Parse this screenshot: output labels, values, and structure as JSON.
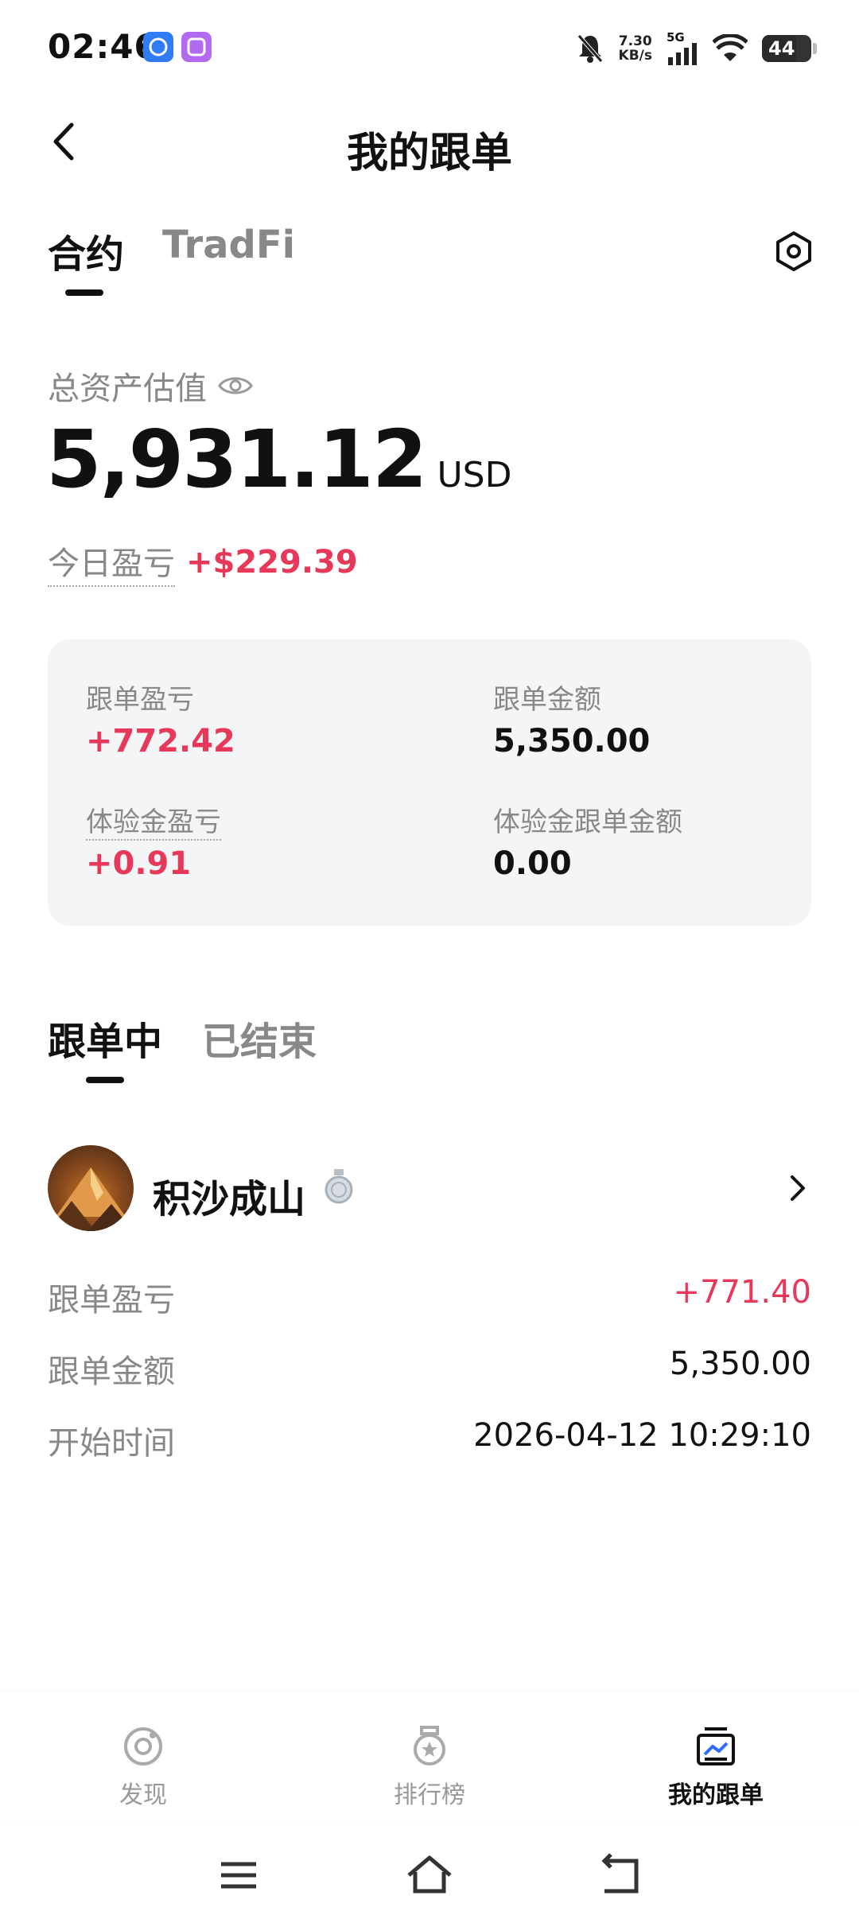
{
  "status_bar": {
    "time": "02:46",
    "net_speed_value": "7.30",
    "net_speed_unit": "KB/s",
    "network": "5G",
    "battery": "44"
  },
  "header": {
    "title": "我的跟单"
  },
  "top_tabs": [
    {
      "label": "合约",
      "active": true
    },
    {
      "label": "TradFi",
      "active": false
    }
  ],
  "assets": {
    "label": "总资产估值",
    "amount": "5,931.12",
    "unit": "USD",
    "today_pnl_label": "今日盈亏",
    "today_pnl_value": "+$229.39"
  },
  "summary_card": {
    "copy_pnl_label": "跟单盈亏",
    "copy_pnl_value": "+772.42",
    "copy_amount_label": "跟单金额",
    "copy_amount_value": "5,350.00",
    "trial_pnl_label": "体验金盈亏",
    "trial_pnl_value": "+0.91",
    "trial_amount_label": "体验金跟单金额",
    "trial_amount_value": "0.00"
  },
  "sub_tabs": [
    {
      "label": "跟单中",
      "active": true
    },
    {
      "label": "已结束",
      "active": false
    }
  ],
  "trader": {
    "name": "积沙成山",
    "details": [
      {
        "label": "跟单盈亏",
        "value": "+771.40"
      },
      {
        "label": "跟单金额",
        "value": "5,350.00"
      },
      {
        "label": "开始时间",
        "value": "2026-04-12 10:29:10"
      }
    ]
  },
  "bottom_nav": [
    {
      "label": "发现",
      "icon": "discover-icon",
      "active": false
    },
    {
      "label": "排行榜",
      "icon": "leaderboard-icon",
      "active": false
    },
    {
      "label": "我的跟单",
      "icon": "my-copy-icon",
      "active": true
    }
  ],
  "colors": {
    "profit": "#e8385a",
    "text": "#111111",
    "muted": "#888888",
    "card_bg": "#f4f5f7"
  }
}
